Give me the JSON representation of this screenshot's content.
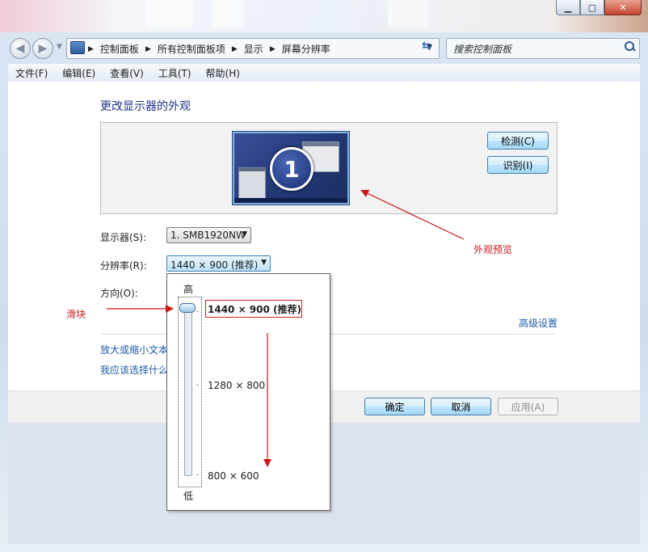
{
  "window": {
    "caption_buttons": [
      "minimize",
      "maximize",
      "close"
    ]
  },
  "navigation": {
    "breadcrumb": [
      "控制面板",
      "所有控制面板项",
      "显示",
      "屏幕分辨率"
    ],
    "search_placeholder": "搜索控制面板"
  },
  "menu": [
    "文件(F)",
    "编辑(E)",
    "查看(V)",
    "工具(T)",
    "帮助(H)"
  ],
  "main": {
    "title": "更改显示器的外观",
    "monitor_number": "1",
    "detect_button": "检测(C)",
    "identify_button": "识别(I)",
    "display_label": "显示器(S):",
    "display_value": "1. SMB1920NW",
    "resolution_label": "分辨率(R):",
    "resolution_value": "1440 × 900 (推荐)",
    "orientation_label": "方向(O):",
    "advanced_link": "高级设置",
    "link_text_size": "放大或缩小文本",
    "link_what_settings": "我应该选择什么"
  },
  "resolution_dropdown": {
    "high_label": "高",
    "low_label": "低",
    "options": [
      "1440 × 900 (推荐)",
      "1280 × 800",
      "800 × 600"
    ],
    "selected_index": 0,
    "slider_position": 1.0
  },
  "buttons": {
    "ok": "确定",
    "cancel": "取消",
    "apply": "应用(A)"
  },
  "annotations": {
    "preview_note": "外观预览",
    "slider_note": "滑块"
  },
  "colors": {
    "annotation_red": "#cc1818",
    "link_blue": "#1e5ba8",
    "title_blue": "#1e3287"
  }
}
